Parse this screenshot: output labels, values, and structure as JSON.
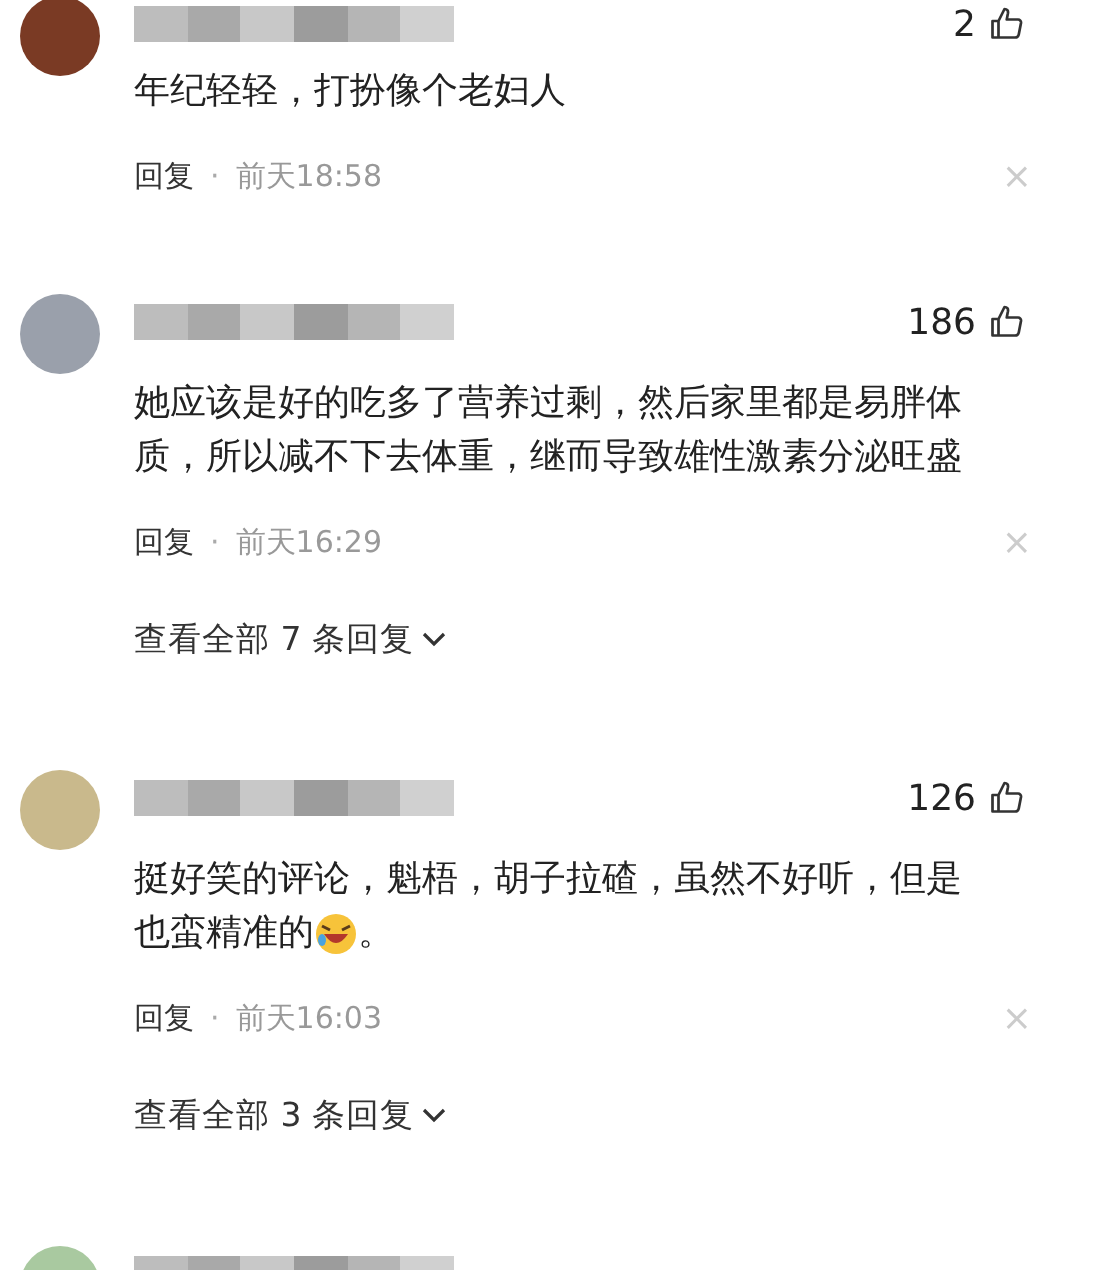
{
  "comments": [
    {
      "color": "#7a3a24",
      "likes": "2",
      "lines": [
        [
          {
            "kind": "text",
            "text": "年纪轻轻，打扮像个老妇人"
          }
        ]
      ],
      "reply": "回复",
      "dot": "·",
      "time": "前天18:58",
      "close": "×"
    },
    {
      "color": "#9aa0ab",
      "likes": "186",
      "lines": [
        [
          {
            "kind": "text",
            "text": "她应该是好的吃多了营养过剩，然后家里都是易胖体"
          }
        ],
        [
          {
            "kind": "text",
            "text": "质，所以减不下去体重，继而导致雄性激素分泌旺盛"
          }
        ]
      ],
      "reply": "回复",
      "dot": "·",
      "time": "前天16:29",
      "close": "×",
      "more": "查看全部 7 条回复"
    },
    {
      "color": "#c9b98c",
      "likes": "126",
      "lines": [
        [
          {
            "kind": "text",
            "text": "挺好笑的评论，魁梧，胡子拉碴，虽然不好听，但是"
          }
        ],
        [
          {
            "kind": "text",
            "text": "也蛮精准的"
          },
          {
            "kind": "emoji"
          },
          {
            "kind": "text",
            "text": "。"
          }
        ]
      ],
      "reply": "回复",
      "dot": "·",
      "time": "前天16:03",
      "close": "×",
      "more": "查看全部 3 条回复"
    },
    {
      "color": "#a9c9a0"
    }
  ]
}
